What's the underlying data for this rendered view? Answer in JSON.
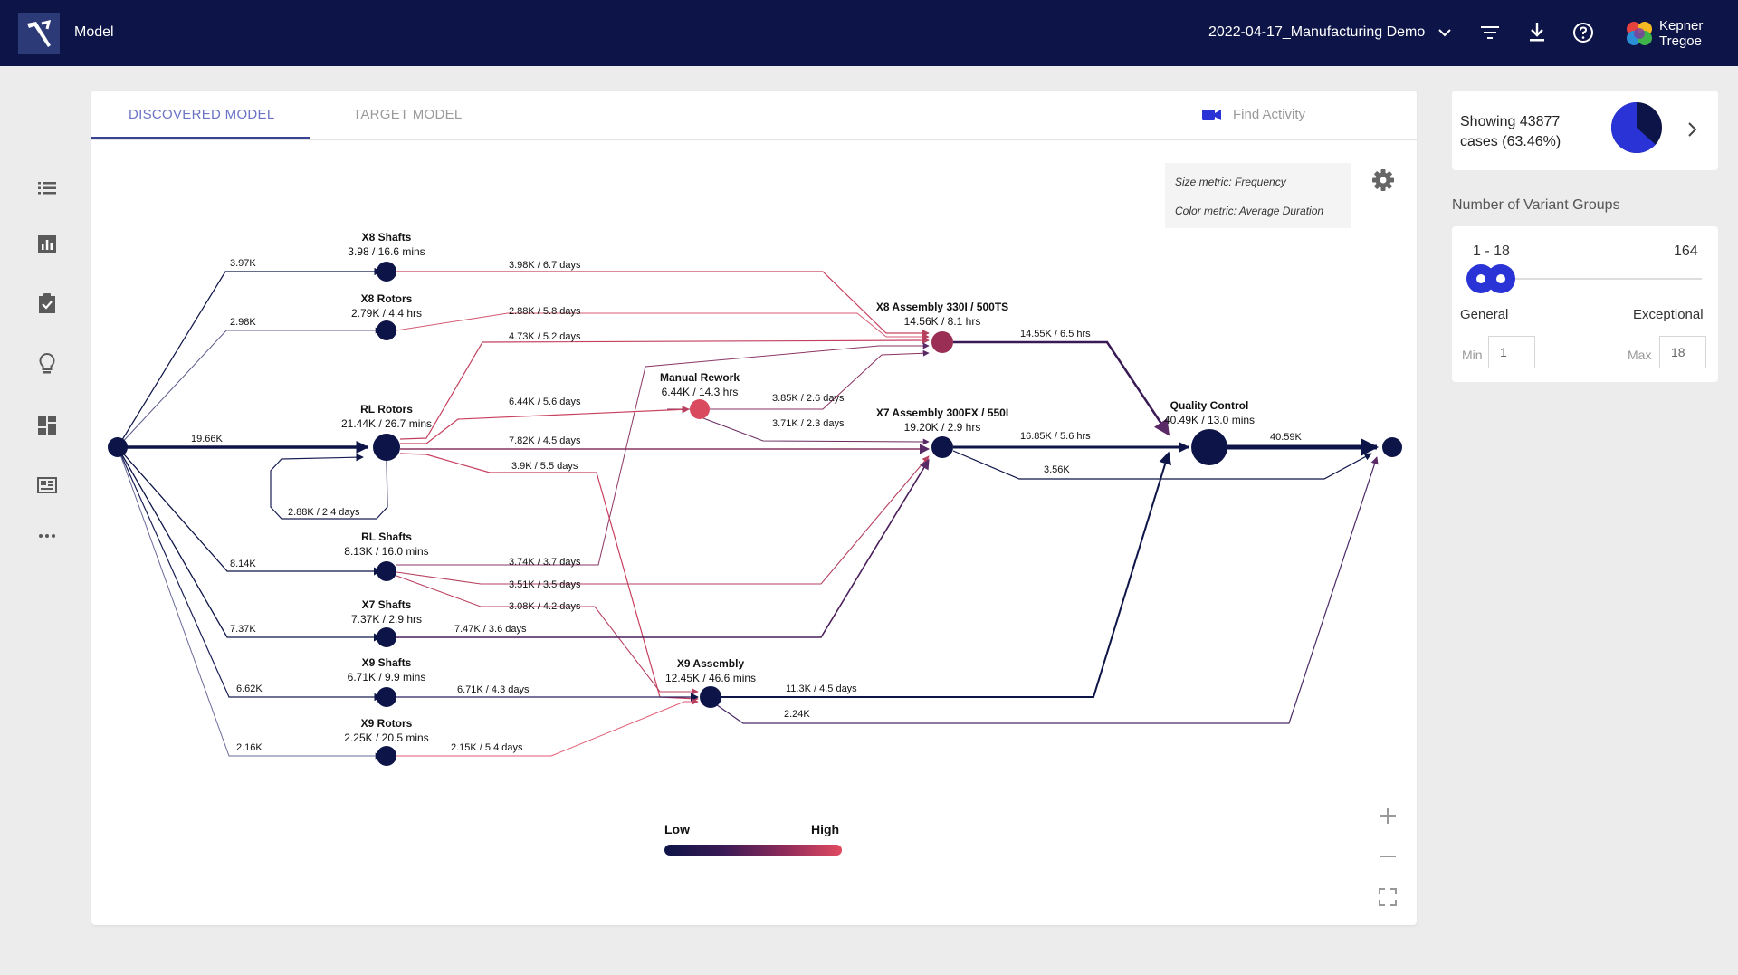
{
  "header": {
    "title": "Model",
    "dataset": "2022-04-17_Manufacturing Demo",
    "brand_line1": "Kepner",
    "brand_line2": "Tregoe"
  },
  "tabs": {
    "discovered": "DISCOVERED MODEL",
    "target": "TARGET MODEL",
    "find_activity": "Find Activity"
  },
  "metrics": {
    "size": "Size metric: Frequency",
    "color": "Color metric: Average Duration"
  },
  "legend": {
    "low": "Low",
    "high": "High"
  },
  "colors": {
    "navy": "#0d1447",
    "accent": "#2a34d6",
    "high": "#e04a60"
  },
  "process_map": {
    "nodes": [
      {
        "id": "x8s",
        "title": "X8 Shafts",
        "sub": "3.98 / 16.6 mins",
        "heat": 0
      },
      {
        "id": "x8r",
        "title": "X8 Rotors",
        "sub": "2.79K / 4.4 hrs",
        "heat": 0
      },
      {
        "id": "rlr",
        "title": "RL Rotors",
        "sub": "21.44K / 26.7 mins",
        "heat": 0
      },
      {
        "id": "mr",
        "title": "Manual Rework",
        "sub": "6.44K / 14.3 hrs",
        "heat": 1
      },
      {
        "id": "x8a",
        "title": "X8 Assembly 330I / 500TS",
        "sub": "14.56K / 8.1 hrs",
        "heat": 0.7
      },
      {
        "id": "x7a",
        "title": "X7 Assembly 300FX / 550I",
        "sub": "19.20K / 2.9 hrs",
        "heat": 0
      },
      {
        "id": "qc",
        "title": "Quality Control",
        "sub": "40.49K / 13.0 mins",
        "heat": 0
      },
      {
        "id": "rls",
        "title": "RL Shafts",
        "sub": "8.13K / 16.0 mins",
        "heat": 0
      },
      {
        "id": "x7s",
        "title": "X7 Shafts",
        "sub": "7.37K / 2.9 hrs",
        "heat": 0
      },
      {
        "id": "x9s",
        "title": "X9 Shafts",
        "sub": "6.71K / 9.9 mins",
        "heat": 0
      },
      {
        "id": "x9a",
        "title": "X9 Assembly",
        "sub": "12.45K / 46.6 mins",
        "heat": 0
      },
      {
        "id": "x9r",
        "title": "X9 Rotors",
        "sub": "2.25K / 20.5 mins",
        "heat": 0
      }
    ],
    "edges": [
      {
        "label": "3.97K",
        "heat": 0
      },
      {
        "label": "2.98K",
        "heat": 0.1
      },
      {
        "label": "19.66K",
        "heat": 0
      },
      {
        "label": "8.14K",
        "heat": 0
      },
      {
        "label": "7.37K",
        "heat": 0
      },
      {
        "label": "6.62K",
        "heat": 0
      },
      {
        "label": "2.16K",
        "heat": 0.1
      },
      {
        "label": "3.98K / 6.7 days",
        "heat": 0.8
      },
      {
        "label": "2.88K / 5.8 days",
        "heat": 0.85
      },
      {
        "label": "4.73K / 5.2 days",
        "heat": 0.75
      },
      {
        "label": "6.44K / 5.6 days",
        "heat": 0.8
      },
      {
        "label": "7.82K / 4.5 days",
        "heat": 0.7
      },
      {
        "label": "3.9K / 5.5 days",
        "heat": 0.8
      },
      {
        "label": "2.88K / 2.4 days",
        "heat": 0.1
      },
      {
        "label": "3.85K / 2.6 days",
        "heat": 0.4
      },
      {
        "label": "3.71K / 2.3 days",
        "heat": 0.4
      },
      {
        "label": "14.55K / 6.5 hrs",
        "heat": 0.3
      },
      {
        "label": "16.85K / 5.6 hrs",
        "heat": 0
      },
      {
        "label": "3.56K",
        "heat": 0
      },
      {
        "label": "40.59K",
        "heat": 0
      },
      {
        "label": "3.74K / 3.7 days",
        "heat": 0.55
      },
      {
        "label": "3.51K / 3.5 days",
        "heat": 0.6
      },
      {
        "label": "3.08K / 4.2 days",
        "heat": 0.7
      },
      {
        "label": "7.47K / 3.6 days",
        "heat": 0.45
      },
      {
        "label": "6.71K / 4.3 days",
        "heat": 0.3
      },
      {
        "label": "11.3K / 4.5 days",
        "heat": 0
      },
      {
        "label": "2.24K",
        "heat": 0.2
      },
      {
        "label": "2.15K / 5.4 days",
        "heat": 0.8
      }
    ]
  },
  "filter_summary": {
    "showing": "Showing 43877",
    "cases": "cases (63.46%)",
    "fraction": 0.6346
  },
  "variant_groups": {
    "title": "Number of Variant Groups",
    "range_label": "1 - 18",
    "max_label": "164",
    "general": "General",
    "exceptional": "Exceptional",
    "min_label": "Min",
    "max_field_label": "Max",
    "min_value": "1",
    "max_value": "18"
  }
}
